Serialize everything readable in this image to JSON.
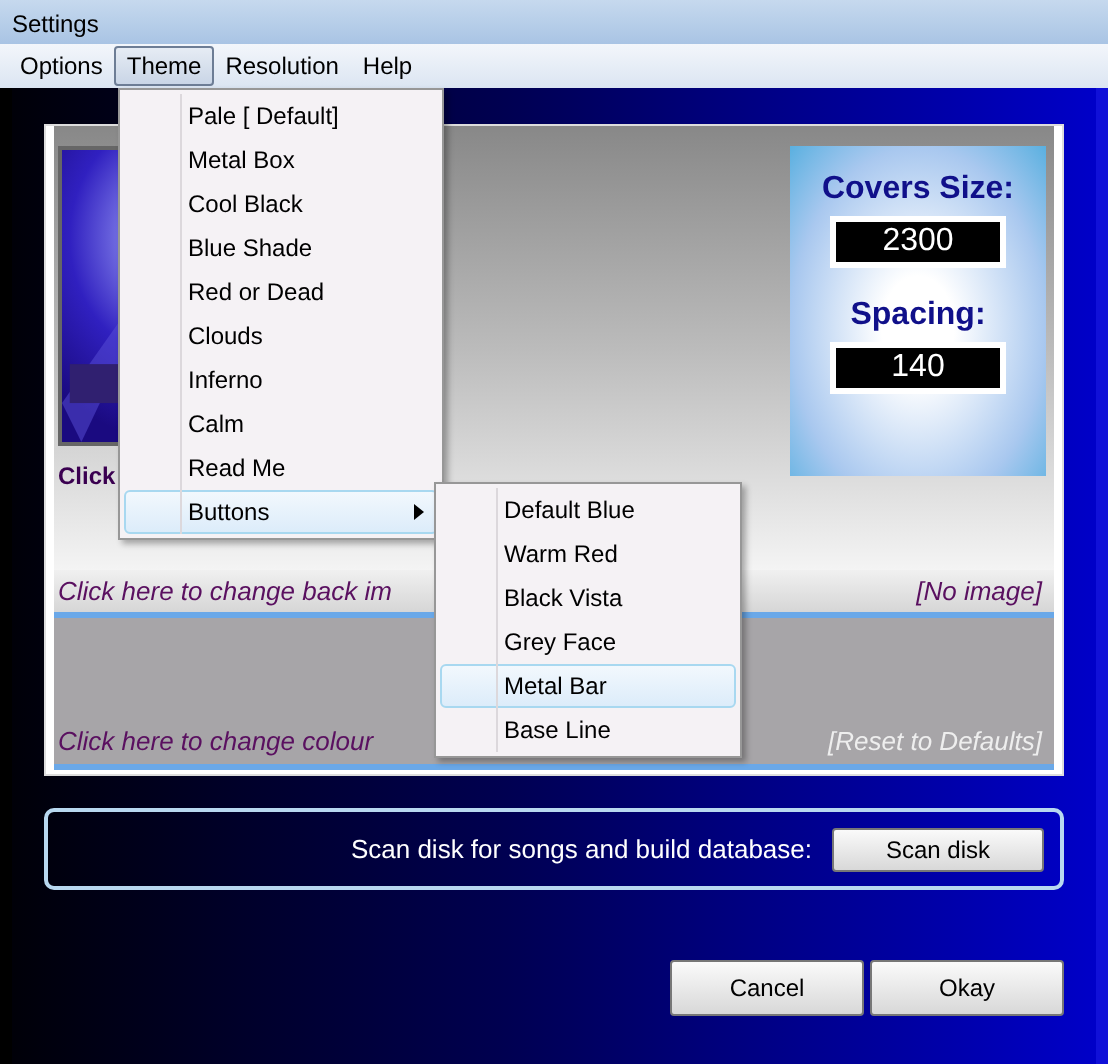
{
  "window": {
    "title": "Settings"
  },
  "menu_bar": [
    {
      "label": "Options",
      "selected": false
    },
    {
      "label": "Theme",
      "selected": true
    },
    {
      "label": "Resolution",
      "selected": false
    },
    {
      "label": "Help",
      "selected": false
    }
  ],
  "theme_menu": [
    {
      "label": "Pale [ Default]",
      "kind": "item",
      "selected": false
    },
    {
      "label": "Metal Box",
      "kind": "item",
      "selected": false
    },
    {
      "label": "Cool Black",
      "kind": "item",
      "selected": false
    },
    {
      "label": "Blue Shade",
      "kind": "item",
      "selected": false
    },
    {
      "label": "Red or Dead",
      "kind": "item",
      "selected": false
    },
    {
      "label": "Clouds",
      "kind": "item",
      "selected": false
    },
    {
      "label": "Inferno",
      "kind": "item",
      "selected": false
    },
    {
      "label": "Calm",
      "kind": "item",
      "selected": false
    },
    {
      "label": "Read Me",
      "kind": "item",
      "selected": false
    },
    {
      "label": "Buttons",
      "kind": "submenu",
      "selected": true
    }
  ],
  "buttons_submenu": [
    {
      "label": "Default Blue",
      "selected": false
    },
    {
      "label": "Warm Red",
      "selected": false
    },
    {
      "label": "Black Vista",
      "selected": false
    },
    {
      "label": "Grey Face",
      "selected": false
    },
    {
      "label": "Metal Bar",
      "selected": true
    },
    {
      "label": "Base Line",
      "selected": false
    }
  ],
  "background_image": {
    "caption": "Click",
    "link": "Click here to change back im",
    "status": "[No image]"
  },
  "covers": {
    "size_label": "Covers Size:",
    "size_value": "2300",
    "spacing_label": "Spacing:",
    "spacing_value": "140"
  },
  "colour": {
    "link": "Click here to change colour",
    "reset": "[Reset to Defaults]"
  },
  "scan": {
    "label": "Scan disk for songs and build database:",
    "button": "Scan disk"
  },
  "buttons": [
    "Cancel",
    "Okay"
  ]
}
